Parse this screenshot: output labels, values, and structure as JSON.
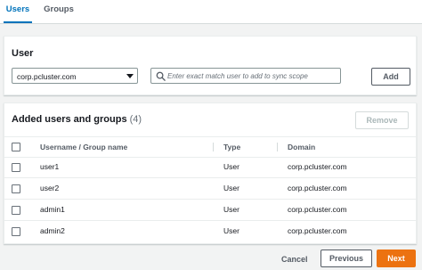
{
  "tabs": [
    {
      "label": "Users",
      "active": true
    },
    {
      "label": "Groups",
      "active": false
    }
  ],
  "user_panel": {
    "title": "User",
    "directory_select": {
      "selected": "corp.pcluster.com"
    },
    "search": {
      "placeholder": "Enter exact match user to add to sync scope",
      "value": ""
    },
    "add_label": "Add"
  },
  "added_panel": {
    "title": "Added users and groups",
    "count": "(4)",
    "remove_label": "Remove",
    "columns": [
      "Username / Group name",
      "Type",
      "Domain"
    ],
    "rows": [
      {
        "name": "user1",
        "type": "User",
        "domain": "corp.pcluster.com"
      },
      {
        "name": "user2",
        "type": "User",
        "domain": "corp.pcluster.com"
      },
      {
        "name": "admin1",
        "type": "User",
        "domain": "corp.pcluster.com"
      },
      {
        "name": "admin2",
        "type": "User",
        "domain": "corp.pcluster.com"
      }
    ]
  },
  "footer": {
    "cancel_label": "Cancel",
    "previous_label": "Previous",
    "next_label": "Next"
  },
  "colors": {
    "accent": "#0073bb",
    "primary_button": "#ec7211"
  }
}
